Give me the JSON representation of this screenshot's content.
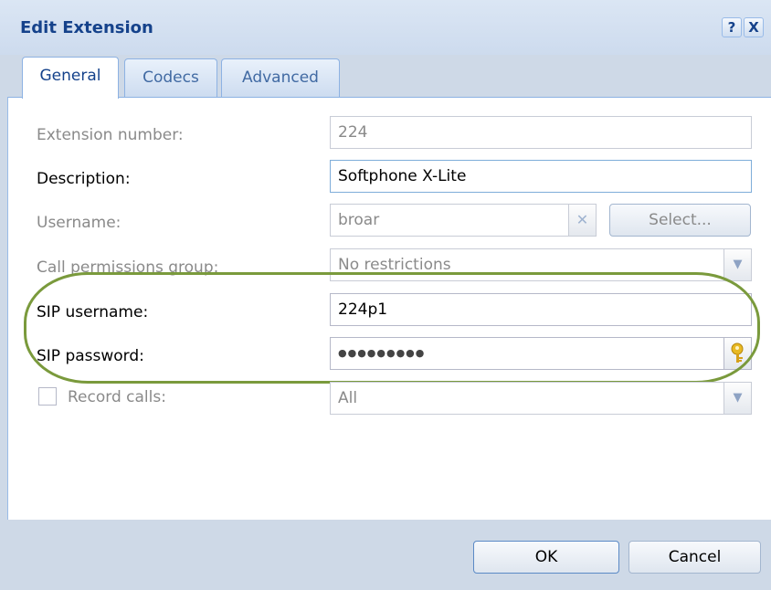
{
  "dialog": {
    "title": "Edit Extension",
    "help_icon": "question-mark-icon",
    "close_icon": "close-icon",
    "help_label": "?",
    "close_label": "X"
  },
  "tabs": [
    {
      "label": "General",
      "active": true
    },
    {
      "label": "Codecs",
      "active": false
    },
    {
      "label": "Advanced",
      "active": false
    }
  ],
  "form": {
    "extension_number": {
      "label": "Extension number:",
      "value": "224",
      "disabled": true
    },
    "description": {
      "label": "Description:",
      "value": "Softphone X-Lite"
    },
    "username": {
      "label": "Username:",
      "value": "broar",
      "clear_icon": "clear-x-icon",
      "select_label": "Select...",
      "disabled": true
    },
    "call_permissions_group": {
      "label": "Call permissions group:",
      "value": "No restrictions",
      "disabled": true
    },
    "sip_username": {
      "label": "SIP username:",
      "value": "224p1"
    },
    "sip_password": {
      "label": "SIP password:",
      "value": "●●●●●●●●●",
      "key_icon": "key-icon"
    },
    "record_calls": {
      "label": "Record calls:",
      "value": "All",
      "checked": false,
      "disabled": true
    }
  },
  "buttons": {
    "ok": "OK",
    "cancel": "Cancel"
  },
  "colors": {
    "title": "#15428b",
    "highlight": "#7a9a3c",
    "tab_border": "#8db2e3"
  }
}
